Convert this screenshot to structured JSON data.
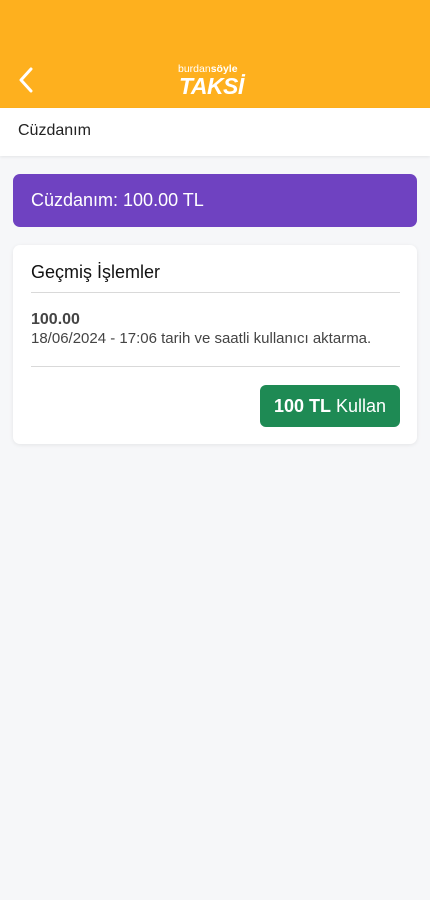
{
  "header": {
    "back_icon": "chevron-left-icon",
    "logo_top_light": "burdan",
    "logo_top_bold": "söyle",
    "logo_main": "TAKSİ",
    "background_color": "#feb01e"
  },
  "subheader": {
    "title": "Cüzdanım"
  },
  "wallet": {
    "label": "Cüzdanım: 100.00 TL",
    "color": "#6f42c1"
  },
  "history": {
    "title": "Geçmiş İşlemler",
    "items": [
      {
        "amount": "100.00",
        "description": "18/06/2024 - 17:06 tarih ve saatli kullanıcı aktarma."
      }
    ]
  },
  "use_button": {
    "amount": "100 TL",
    "action": "Kullan",
    "color": "#1e8a54"
  }
}
